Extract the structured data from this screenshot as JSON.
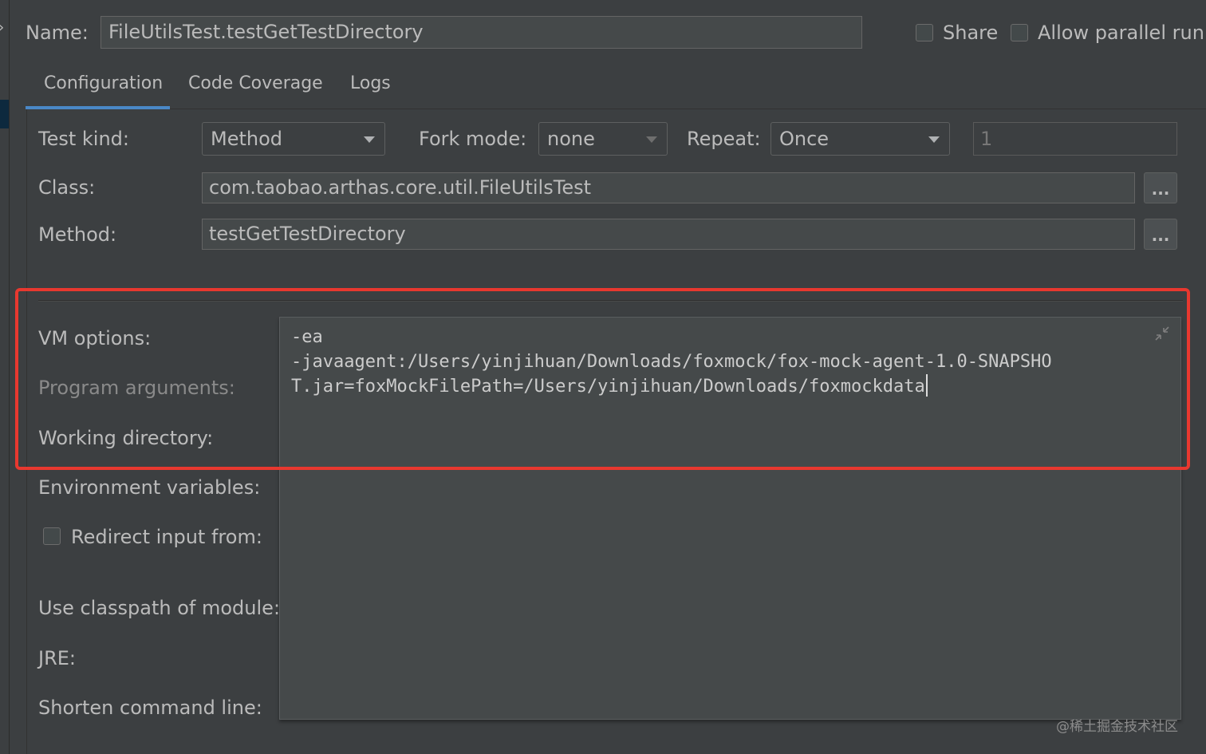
{
  "header": {
    "name_label": "Name:",
    "name_value": "FileUtilsTest.testGetTestDirectory",
    "share_label": "Share",
    "parallel_label": "Allow parallel run"
  },
  "tabs": [
    {
      "label": "Configuration",
      "active": true
    },
    {
      "label": "Code Coverage",
      "active": false
    },
    {
      "label": "Logs",
      "active": false
    }
  ],
  "form": {
    "test_kind_label": "Test kind:",
    "test_kind_value": "Method",
    "fork_mode_label": "Fork mode:",
    "fork_mode_value": "none",
    "repeat_label": "Repeat:",
    "repeat_value": "Once",
    "repeat_count": "1",
    "class_label": "Class:",
    "class_value": "com.taobao.arthas.core.util.FileUtilsTest",
    "method_label": "Method:",
    "method_value": "testGetTestDirectory",
    "ellipsis": "...",
    "vm_options_label": "VM options:",
    "program_args_label": "Program arguments:",
    "working_dir_label": "Working directory:",
    "env_vars_label": "Environment variables:",
    "redirect_label": "Redirect input from:",
    "classpath_label": "Use classpath of module:",
    "jre_label": "JRE:",
    "shorten_label": "Shorten command line:"
  },
  "vm_options": {
    "line1": "-ea",
    "line2": "-javaagent:/Users/yinjihuan/Downloads/foxmock/fox-mock-agent-1.0-SNAPSHO",
    "line3": "T.jar=foxMockFilePath=/Users/yinjihuan/Downloads/foxmockdata"
  },
  "watermark": "@稀土掘金技术社区",
  "colors": {
    "background": "#3c3f41",
    "field": "#45494a",
    "accent": "#4a88c7",
    "highlight": "#e8382f"
  }
}
